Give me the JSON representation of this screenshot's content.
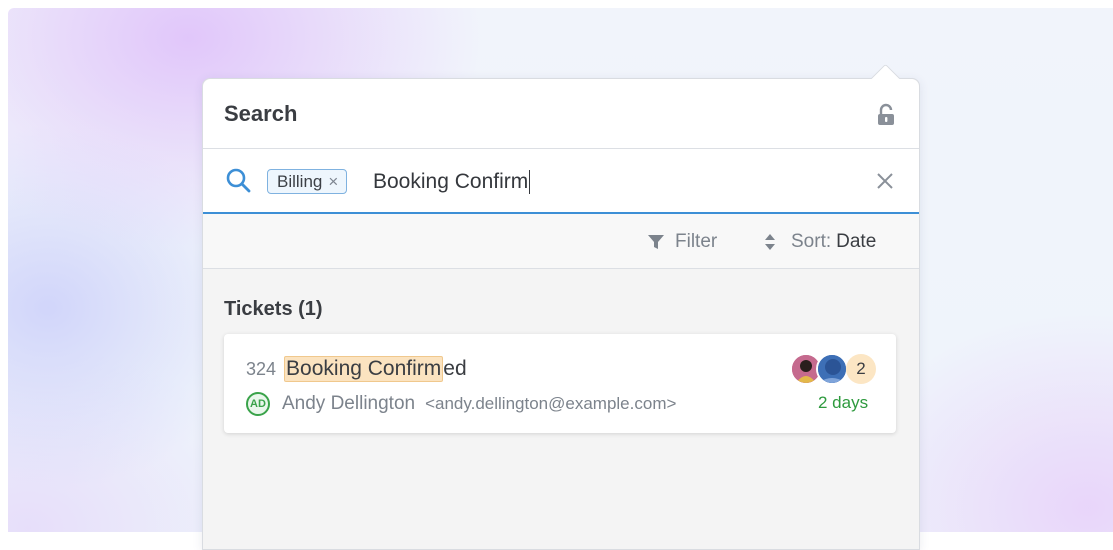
{
  "panel": {
    "title": "Search"
  },
  "search": {
    "chip_label": "Billing",
    "chip_remove": "×",
    "query": "Booking Confirm"
  },
  "toolbar": {
    "filter_label": "Filter",
    "sort_label": "Sort:",
    "sort_value": "Date"
  },
  "results": {
    "section_title": "Tickets (1)",
    "tickets": [
      {
        "number": "324",
        "title_match": "Booking Confirm",
        "title_rest": "ed",
        "requester_initials": "AD",
        "requester_name": "Andy Dellington",
        "requester_email": "<andy.dellington@example.com>",
        "agent_count": "2",
        "age": "2 days"
      }
    ]
  },
  "colors": {
    "accent": "#3d8fd6",
    "highlight": "#fbe3c0",
    "success": "#2e9a3e"
  },
  "icons": [
    "search-icon",
    "lock-open-icon",
    "close-icon",
    "filter-icon",
    "sort-icon"
  ]
}
